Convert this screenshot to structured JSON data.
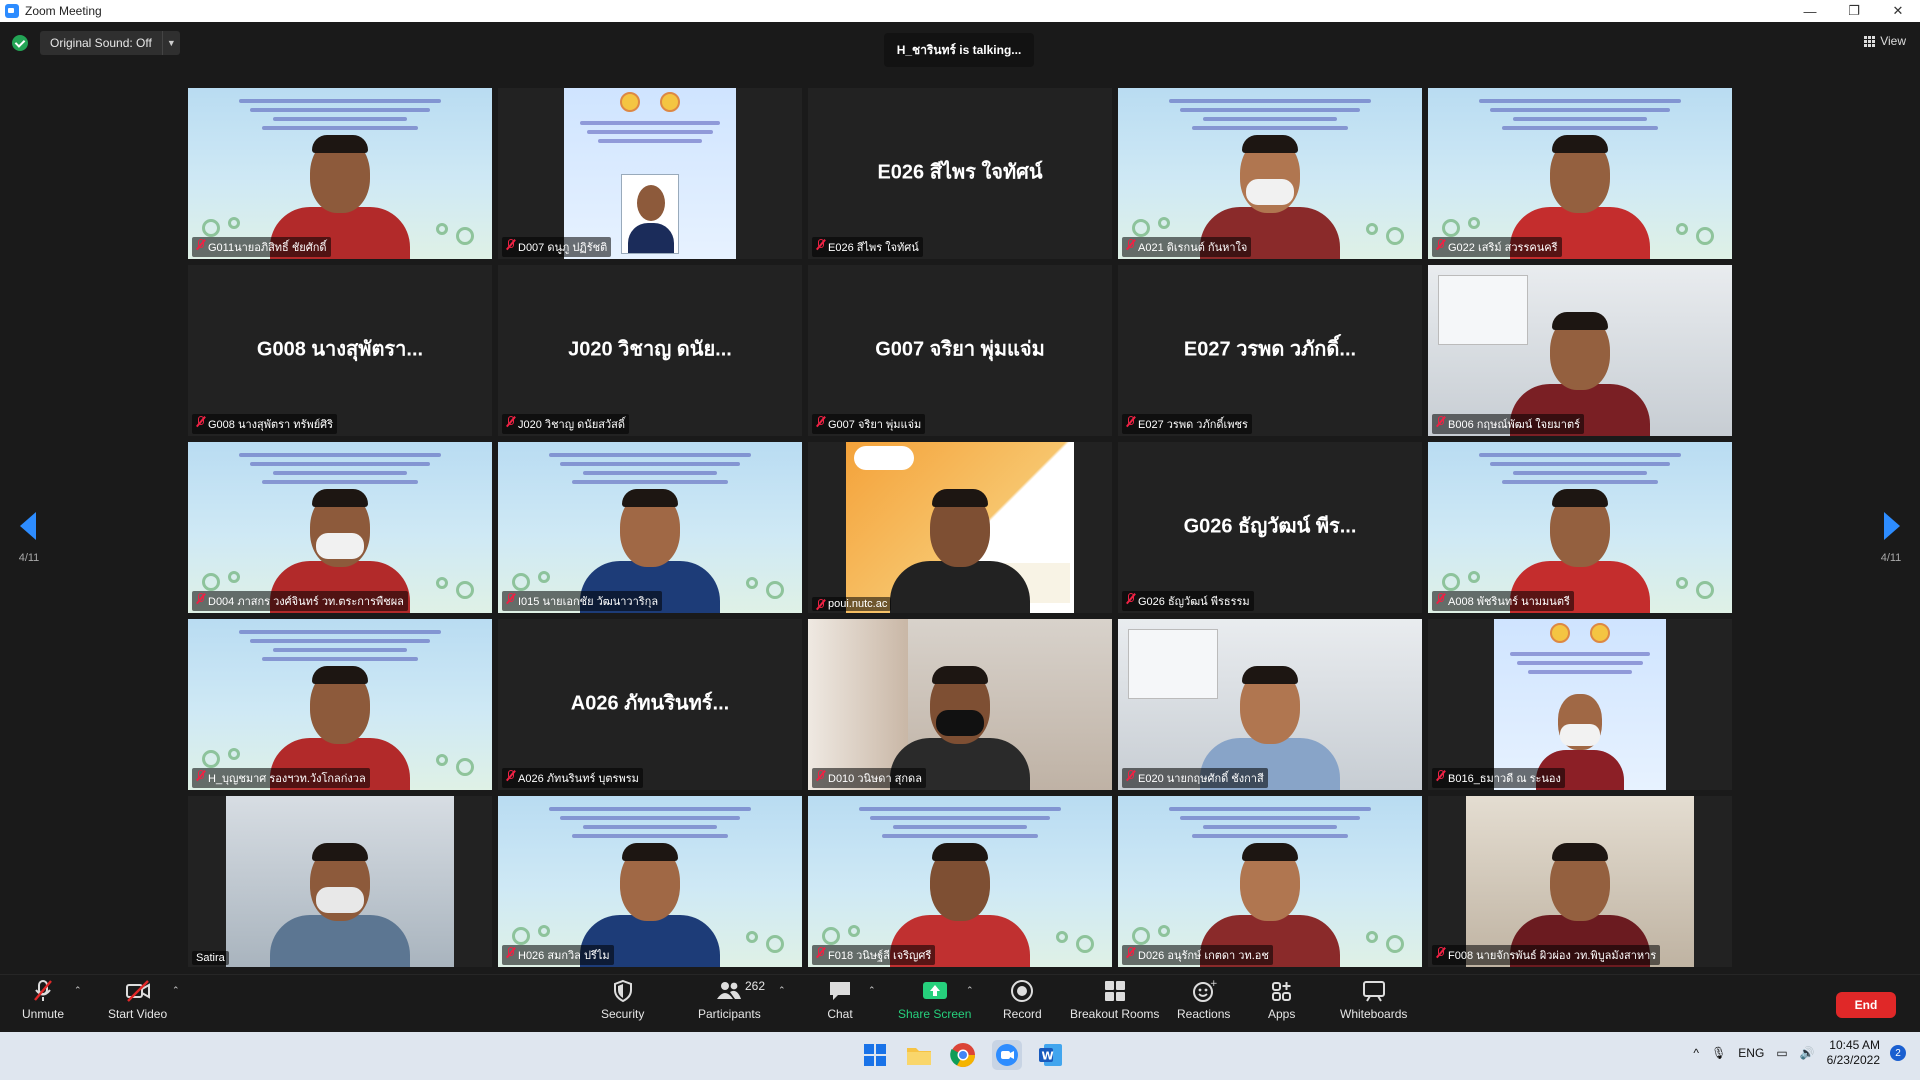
{
  "window": {
    "title": "Zoom Meeting",
    "controls": [
      "—",
      "❐",
      "✕"
    ]
  },
  "topbar": {
    "original_sound": "Original Sound: Off",
    "talking": "H_ชารินทร์ is  talking...",
    "view": "View"
  },
  "pagination": {
    "left": "4/11",
    "right": "4/11"
  },
  "tiles": [
    {
      "name": "G011นายอภิสิทธิ์ ชัยศักดิ์",
      "big": "",
      "kind": "slide"
    },
    {
      "name": "D007 ดนูภู ปฏิรัชติ",
      "big": "",
      "kind": "poster"
    },
    {
      "name": "E026 สีไพร ใจทัศน์",
      "big": "E026 สีไพร ใจทัศน์",
      "kind": "dark"
    },
    {
      "name": "A021 ดิเรกนต์ กันหาใจ",
      "big": "",
      "kind": "slide"
    },
    {
      "name": "G022 เสริม์ สวรรคนครี",
      "big": "",
      "kind": "slide"
    },
    {
      "name": "G008 นางสุพัตรา  ทรัพย์ศิริ",
      "big": "G008 นางสุพัตรา...",
      "kind": "dark"
    },
    {
      "name": "J020 วิชาญ  ดนัยสวัสดิ์",
      "big": "J020 วิชาญ  ดนัย...",
      "kind": "dark"
    },
    {
      "name": "G007 จริยา พุ่มแจ่ม",
      "big": "G007 จริยา พุ่มแจ่ม",
      "kind": "dark"
    },
    {
      "name": "E027 วรพด วภักดิ์เพชร",
      "big": "E027 วรพด วภักดิ์...",
      "kind": "dark"
    },
    {
      "name": "B006 กฤษณ์พัฒน์  ใจยมาตร์",
      "big": "",
      "kind": "office"
    },
    {
      "name": "D004 ภาสกร วงศ์จินทร์ วท.ตระการพืชผล",
      "big": "",
      "kind": "slide"
    },
    {
      "name": "I015 นายเอกชัย วัฒนาวาริกุล",
      "big": "",
      "kind": "slide"
    },
    {
      "name": "poui.nutc.ac",
      "big": "",
      "kind": "banner"
    },
    {
      "name": "G026 ธัญวัฒน์ พีรธรรม",
      "big": "G026 ธัญวัฒน์ พีร...",
      "kind": "dark"
    },
    {
      "name": "A008 พัชรินทร์ นามมนตรี",
      "big": "",
      "kind": "slide"
    },
    {
      "name": "H_บุญชมาศ รองฯวท.วังโกลก่งวล",
      "big": "",
      "kind": "slide"
    },
    {
      "name": "A026 ภัทนรินทร์ บุตรพรม",
      "big": "A026 ภัทนรินทร์...",
      "kind": "dark"
    },
    {
      "name": "D010 วนิษดา สุกดล",
      "big": "",
      "kind": "room"
    },
    {
      "name": "E020 นายกฤษศักดิ์ ชังกาสี",
      "big": "",
      "kind": "office"
    },
    {
      "name": "B016_ธมาวดี ณ  ระนอง",
      "big": "",
      "kind": "poster2"
    },
    {
      "name": "Satira",
      "big": "",
      "kind": "office2"
    },
    {
      "name": "H026 สมกวิล ปรีไม",
      "big": "",
      "kind": "slide"
    },
    {
      "name": "F018 วนิษฐ์ลี เจริญศรี",
      "big": "",
      "kind": "slide"
    },
    {
      "name": "D026 อนุรักษ์ เกตดา วท.อช",
      "big": "",
      "kind": "slide"
    },
    {
      "name": "F008 นายจักรพันธ์ ผิวผ่อง วท.พิบูลมังสาหาร",
      "big": "",
      "kind": "room2"
    }
  ],
  "controls": {
    "unmute": "Unmute",
    "start_video": "Start Video",
    "security": "Security",
    "participants": "Participants",
    "participants_count": "262",
    "chat": "Chat",
    "share_screen": "Share Screen",
    "record": "Record",
    "breakout_rooms": "Breakout Rooms",
    "reactions": "Reactions",
    "apps": "Apps",
    "whiteboards": "Whiteboards",
    "end": "End"
  },
  "taskbar": {
    "lang": "ENG",
    "time": "10:45 AM",
    "date": "6/23/2022",
    "notifications": "2"
  },
  "colors": {
    "accent": "#2d8cff",
    "end": "#e02828",
    "share": "#26d07c",
    "muted": "#e22244"
  }
}
